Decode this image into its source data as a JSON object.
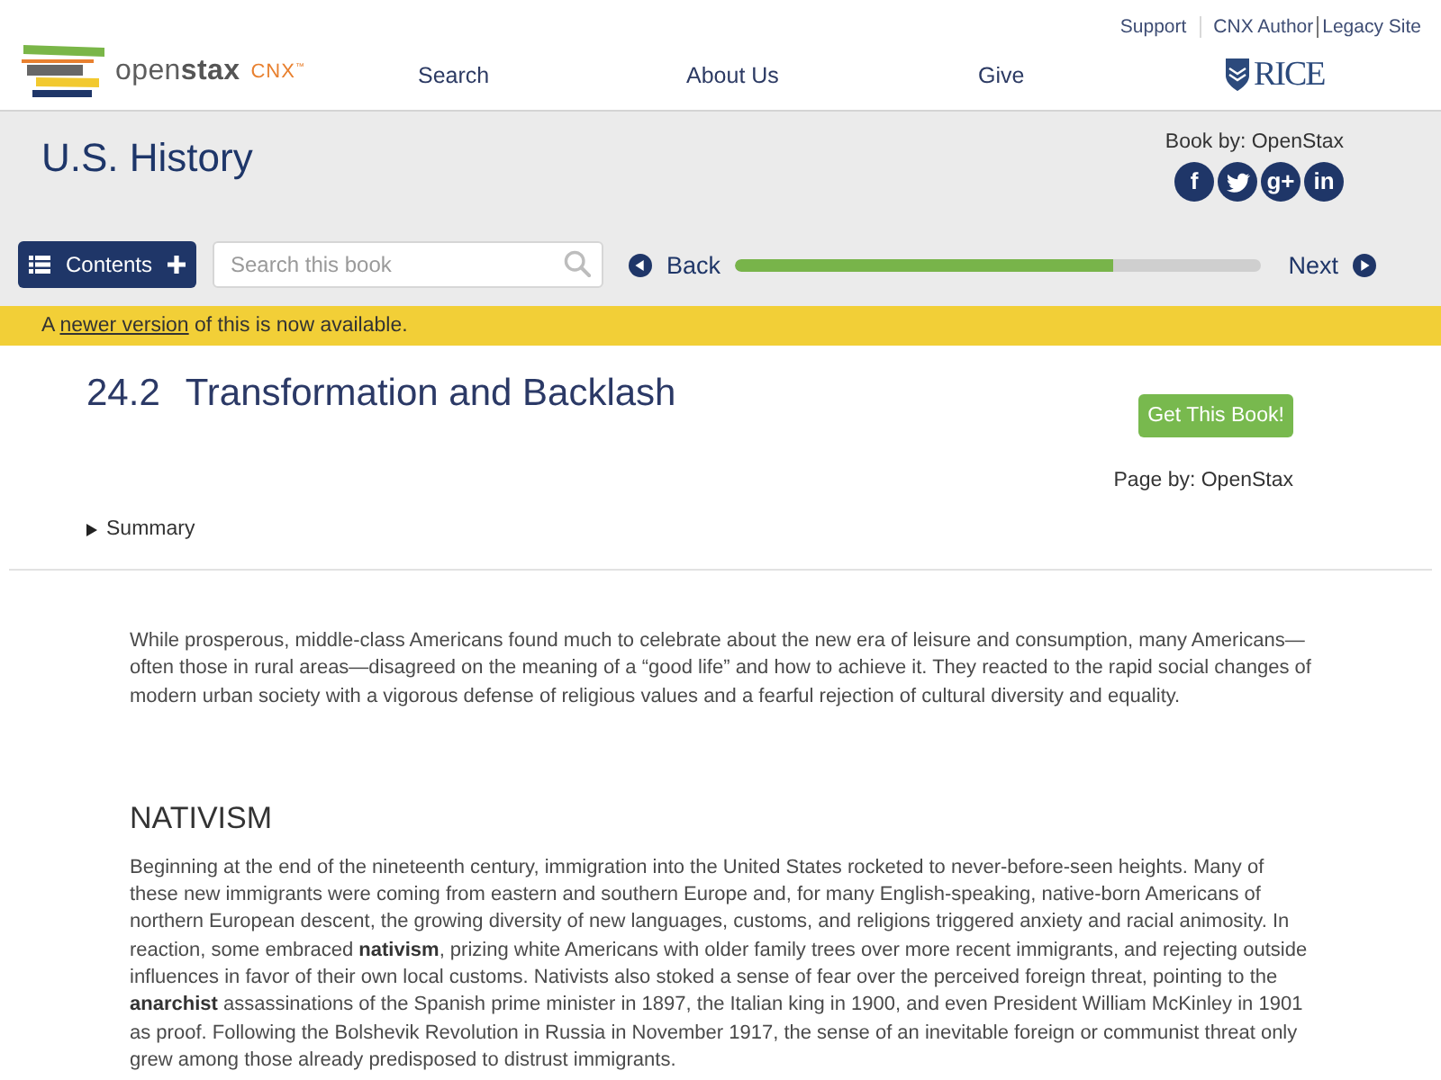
{
  "header": {
    "logo": {
      "wordmark": "open**stax**",
      "suffix": "CNX$^{™}$"
    },
    "top_links": [
      "Support",
      "CNX Author",
      "Legacy Site"
    ],
    "nav": [
      "Search",
      "About Us",
      "Give"
    ],
    "partner_logo": "RICE"
  },
  "book": {
    "title": "U.S. History",
    "credit": "Book by: OpenStax",
    "share": [
      {
        "kind": "facebook",
        "glyph": "f"
      },
      {
        "kind": "twitter"
      },
      {
        "kind": "google-plus",
        "glyph": "g+"
      },
      {
        "kind": "linkedin",
        "glyph": "in"
      }
    ]
  },
  "toolbar": {
    "contents": "Contents",
    "search": {
      "placeholder": "Search this book"
    },
    "back": "Back",
    "next": "Next",
    "progress": {
      "level": 0.718
    }
  },
  "notice": {
    "before": "A ",
    "link": "newer version",
    "after": " of this is now available."
  },
  "page": {
    "number": "24.2",
    "title": "Transformation and Backlash",
    "get_book": "Get This Book!",
    "credit": "Page by: OpenStax",
    "summary": "Summary",
    "intro": "While prosperous, middle-class Americans found much to celebrate about the new era of leisure and consumption, many Americans—often those in rural areas—disagreed on the meaning of a “good life” and how to achieve it. They reacted to the rapid social changes of modern urban society with a vigorous defense of religious values and a fearful rejection of cultural diversity and equality.",
    "sections": [
      {
        "heading": "NATIVISM",
        "text": "Beginning at the end of the nineteenth century, immigration into the United States rocketed to never-before-seen heights. Many of these new immigrants were coming from eastern and southern Europe and, for many English-speaking, native-born Americans of northern European descent, the growing diversity of new languages, customs, and religions triggered anxiety and racial animosity. In reaction, some embraced **nativism**, prizing white Americans with older family trees over more recent immigrants, and rejecting outside influences in favor of their own local customs. Nativists also stoked a sense of fear over the perceived foreign threat, pointing to the **anarchist** assassinations of the Spanish prime minister in 1897, the Italian king in 1900, and even President William McKinley in 1901 as proof. Following the Bolshevik Revolution in Russia in November 1917, the sense of an inevitable foreign or communist threat only grew among those already predisposed to distrust immigrants."
      }
    ]
  }
}
